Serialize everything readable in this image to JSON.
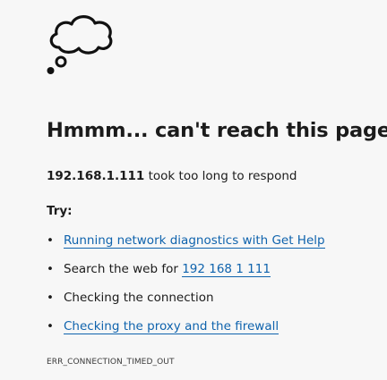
{
  "icon": "thought-cloud-icon",
  "headline": "Hmmm... can't reach this page",
  "subline": {
    "host": "192.168.1.111",
    "message": " took too long to respond"
  },
  "try_label": "Try:",
  "suggestions": [
    {
      "bullet": "•",
      "link": "Running network diagnostics with Get Help"
    },
    {
      "bullet": "•",
      "prefix": "Search the web for ",
      "link": "192 168 1 111"
    },
    {
      "bullet": "•",
      "text": "Checking the connection"
    },
    {
      "bullet": "•",
      "link": "Checking the proxy and the firewall"
    }
  ],
  "error_code": "ERR_CONNECTION_TIMED_OUT",
  "colors": {
    "background": "#f7f7f7",
    "text": "#1b1b1b",
    "link": "#0f63ad"
  }
}
